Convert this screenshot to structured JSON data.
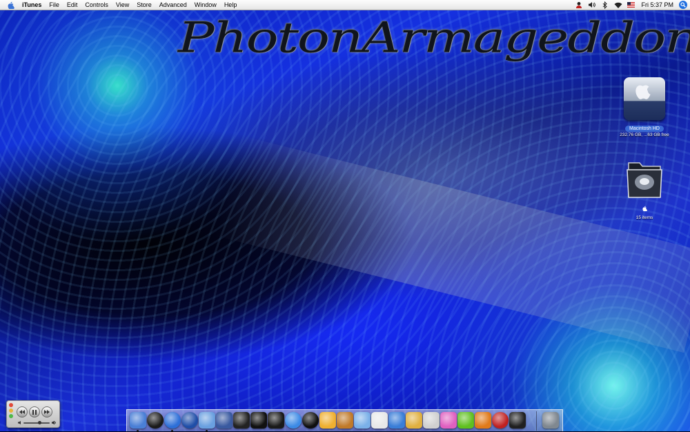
{
  "menubar": {
    "app_name": "iTunes",
    "menus": [
      "File",
      "Edit",
      "Controls",
      "View",
      "Store",
      "Advanced",
      "Window",
      "Help"
    ],
    "status_icons": [
      "user-icon",
      "volume-icon",
      "bluetooth-icon",
      "wifi-icon",
      "flag-icon"
    ],
    "clock": "Fri 5:37 PM"
  },
  "wallpaper": {
    "title_text": "PhotonArmageddon"
  },
  "desktop_icons": {
    "hard_drive": {
      "label": "Macintosh HD",
      "info": "232.76 GB, ...63 GB free"
    },
    "folder": {
      "label": "",
      "info": "15 items"
    }
  },
  "mini_player": {
    "volume_level": 0.6
  },
  "dock": {
    "items": [
      {
        "name": "finder",
        "color": "#4a7fd6"
      },
      {
        "name": "dashboard",
        "color": "#1a1a1a"
      },
      {
        "name": "safari",
        "color": "#2d6fd8"
      },
      {
        "name": "network-globe",
        "color": "#1f4ea8"
      },
      {
        "name": "itunes",
        "color": "#6aa0e0"
      },
      {
        "name": "iphoto",
        "color": "#3a5aa0"
      },
      {
        "name": "imovie",
        "color": "#222222"
      },
      {
        "name": "final-cut",
        "color": "#111111"
      },
      {
        "name": "clapboard",
        "color": "#1a1a1a"
      },
      {
        "name": "ichat",
        "color": "#3b8ae6"
      },
      {
        "name": "ichat-video",
        "color": "#0f0f0f"
      },
      {
        "name": "adium",
        "color": "#f0b030"
      },
      {
        "name": "guitar",
        "color": "#c07a2a"
      },
      {
        "name": "scissors-tool",
        "color": "#7ab0e8"
      },
      {
        "name": "text-edit",
        "color": "#e8e8e8"
      },
      {
        "name": "dictionary",
        "color": "#3a7ed8"
      },
      {
        "name": "ilife-pen",
        "color": "#e0b040"
      },
      {
        "name": "pencil-app",
        "color": "#d0d0d0"
      },
      {
        "name": "flower-app",
        "color": "#e060c0"
      },
      {
        "name": "cube-app",
        "color": "#60c020"
      },
      {
        "name": "reason-app",
        "color": "#e07a1a"
      },
      {
        "name": "music-circle",
        "color": "#c02020"
      },
      {
        "name": "piano-app",
        "color": "#202020"
      },
      {
        "name": "trash",
        "color": "#808890"
      }
    ]
  }
}
